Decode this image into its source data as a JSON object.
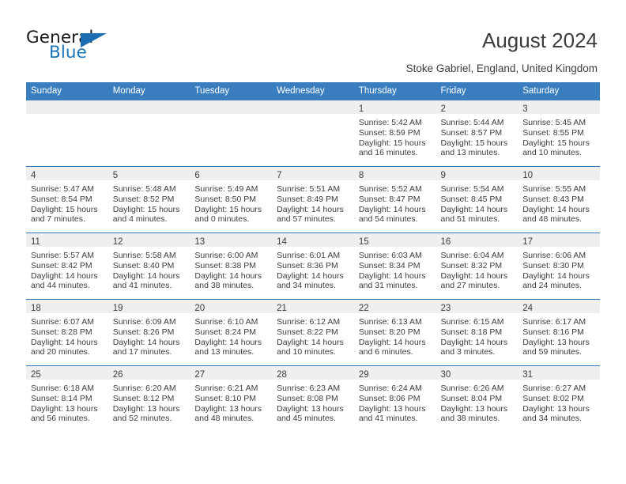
{
  "brand": {
    "name_part1": "General",
    "name_part2": "Blue",
    "logo_icon": "triangle-icon",
    "accent_color": "#1b6cb0"
  },
  "header": {
    "title": "August 2024",
    "location": "Stoke Gabriel, England, United Kingdom"
  },
  "colors": {
    "header_row_bg": "#3a7ebf",
    "daynum_band_bg": "#efefef",
    "row_divider": "#2e75b6",
    "text": "#3c3c3c",
    "brand_blue": "#1b75bb"
  },
  "weekday_headers": [
    "Sunday",
    "Monday",
    "Tuesday",
    "Wednesday",
    "Thursday",
    "Friday",
    "Saturday"
  ],
  "weeks": [
    [
      {
        "day": "",
        "lines": []
      },
      {
        "day": "",
        "lines": []
      },
      {
        "day": "",
        "lines": []
      },
      {
        "day": "",
        "lines": []
      },
      {
        "day": "1",
        "lines": [
          "Sunrise: 5:42 AM",
          "Sunset: 8:59 PM",
          "Daylight: 15 hours",
          "and 16 minutes."
        ]
      },
      {
        "day": "2",
        "lines": [
          "Sunrise: 5:44 AM",
          "Sunset: 8:57 PM",
          "Daylight: 15 hours",
          "and 13 minutes."
        ]
      },
      {
        "day": "3",
        "lines": [
          "Sunrise: 5:45 AM",
          "Sunset: 8:55 PM",
          "Daylight: 15 hours",
          "and 10 minutes."
        ]
      }
    ],
    [
      {
        "day": "4",
        "lines": [
          "Sunrise: 5:47 AM",
          "Sunset: 8:54 PM",
          "Daylight: 15 hours",
          "and 7 minutes."
        ]
      },
      {
        "day": "5",
        "lines": [
          "Sunrise: 5:48 AM",
          "Sunset: 8:52 PM",
          "Daylight: 15 hours",
          "and 4 minutes."
        ]
      },
      {
        "day": "6",
        "lines": [
          "Sunrise: 5:49 AM",
          "Sunset: 8:50 PM",
          "Daylight: 15 hours",
          "and 0 minutes."
        ]
      },
      {
        "day": "7",
        "lines": [
          "Sunrise: 5:51 AM",
          "Sunset: 8:49 PM",
          "Daylight: 14 hours",
          "and 57 minutes."
        ]
      },
      {
        "day": "8",
        "lines": [
          "Sunrise: 5:52 AM",
          "Sunset: 8:47 PM",
          "Daylight: 14 hours",
          "and 54 minutes."
        ]
      },
      {
        "day": "9",
        "lines": [
          "Sunrise: 5:54 AM",
          "Sunset: 8:45 PM",
          "Daylight: 14 hours",
          "and 51 minutes."
        ]
      },
      {
        "day": "10",
        "lines": [
          "Sunrise: 5:55 AM",
          "Sunset: 8:43 PM",
          "Daylight: 14 hours",
          "and 48 minutes."
        ]
      }
    ],
    [
      {
        "day": "11",
        "lines": [
          "Sunrise: 5:57 AM",
          "Sunset: 8:42 PM",
          "Daylight: 14 hours",
          "and 44 minutes."
        ]
      },
      {
        "day": "12",
        "lines": [
          "Sunrise: 5:58 AM",
          "Sunset: 8:40 PM",
          "Daylight: 14 hours",
          "and 41 minutes."
        ]
      },
      {
        "day": "13",
        "lines": [
          "Sunrise: 6:00 AM",
          "Sunset: 8:38 PM",
          "Daylight: 14 hours",
          "and 38 minutes."
        ]
      },
      {
        "day": "14",
        "lines": [
          "Sunrise: 6:01 AM",
          "Sunset: 8:36 PM",
          "Daylight: 14 hours",
          "and 34 minutes."
        ]
      },
      {
        "day": "15",
        "lines": [
          "Sunrise: 6:03 AM",
          "Sunset: 8:34 PM",
          "Daylight: 14 hours",
          "and 31 minutes."
        ]
      },
      {
        "day": "16",
        "lines": [
          "Sunrise: 6:04 AM",
          "Sunset: 8:32 PM",
          "Daylight: 14 hours",
          "and 27 minutes."
        ]
      },
      {
        "day": "17",
        "lines": [
          "Sunrise: 6:06 AM",
          "Sunset: 8:30 PM",
          "Daylight: 14 hours",
          "and 24 minutes."
        ]
      }
    ],
    [
      {
        "day": "18",
        "lines": [
          "Sunrise: 6:07 AM",
          "Sunset: 8:28 PM",
          "Daylight: 14 hours",
          "and 20 minutes."
        ]
      },
      {
        "day": "19",
        "lines": [
          "Sunrise: 6:09 AM",
          "Sunset: 8:26 PM",
          "Daylight: 14 hours",
          "and 17 minutes."
        ]
      },
      {
        "day": "20",
        "lines": [
          "Sunrise: 6:10 AM",
          "Sunset: 8:24 PM",
          "Daylight: 14 hours",
          "and 13 minutes."
        ]
      },
      {
        "day": "21",
        "lines": [
          "Sunrise: 6:12 AM",
          "Sunset: 8:22 PM",
          "Daylight: 14 hours",
          "and 10 minutes."
        ]
      },
      {
        "day": "22",
        "lines": [
          "Sunrise: 6:13 AM",
          "Sunset: 8:20 PM",
          "Daylight: 14 hours",
          "and 6 minutes."
        ]
      },
      {
        "day": "23",
        "lines": [
          "Sunrise: 6:15 AM",
          "Sunset: 8:18 PM",
          "Daylight: 14 hours",
          "and 3 minutes."
        ]
      },
      {
        "day": "24",
        "lines": [
          "Sunrise: 6:17 AM",
          "Sunset: 8:16 PM",
          "Daylight: 13 hours",
          "and 59 minutes."
        ]
      }
    ],
    [
      {
        "day": "25",
        "lines": [
          "Sunrise: 6:18 AM",
          "Sunset: 8:14 PM",
          "Daylight: 13 hours",
          "and 56 minutes."
        ]
      },
      {
        "day": "26",
        "lines": [
          "Sunrise: 6:20 AM",
          "Sunset: 8:12 PM",
          "Daylight: 13 hours",
          "and 52 minutes."
        ]
      },
      {
        "day": "27",
        "lines": [
          "Sunrise: 6:21 AM",
          "Sunset: 8:10 PM",
          "Daylight: 13 hours",
          "and 48 minutes."
        ]
      },
      {
        "day": "28",
        "lines": [
          "Sunrise: 6:23 AM",
          "Sunset: 8:08 PM",
          "Daylight: 13 hours",
          "and 45 minutes."
        ]
      },
      {
        "day": "29",
        "lines": [
          "Sunrise: 6:24 AM",
          "Sunset: 8:06 PM",
          "Daylight: 13 hours",
          "and 41 minutes."
        ]
      },
      {
        "day": "30",
        "lines": [
          "Sunrise: 6:26 AM",
          "Sunset: 8:04 PM",
          "Daylight: 13 hours",
          "and 38 minutes."
        ]
      },
      {
        "day": "31",
        "lines": [
          "Sunrise: 6:27 AM",
          "Sunset: 8:02 PM",
          "Daylight: 13 hours",
          "and 34 minutes."
        ]
      }
    ]
  ]
}
